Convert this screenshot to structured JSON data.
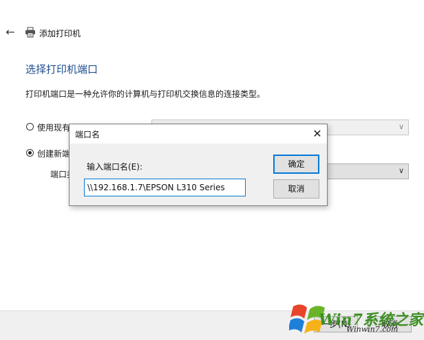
{
  "window": {
    "title": "添加打印机",
    "back_icon": "back-arrow-icon",
    "printer_icon": "printer-icon"
  },
  "page": {
    "heading": "选择打印机端口",
    "description": "打印机端口是一种允许你的计算机与打印机交换信息的连接类型。"
  },
  "options": {
    "use_existing": {
      "label": "使用现有",
      "selected": false
    },
    "create_new": {
      "label": "创建新端",
      "selected": true
    },
    "port_type_label": "端口类"
  },
  "dialog": {
    "title": "端口名",
    "field_label": "输入端口名(E):",
    "field_value": "\\\\192.168.1.7\\EPSON L310 Series",
    "ok_label": "确定",
    "cancel_label": "取消",
    "close_icon": "close-icon"
  },
  "footer": {
    "next_label": "一步(N)",
    "cancel_label": "取消"
  },
  "watermark": {
    "text": "Win7系统之家",
    "url": "Winwin7.com"
  }
}
